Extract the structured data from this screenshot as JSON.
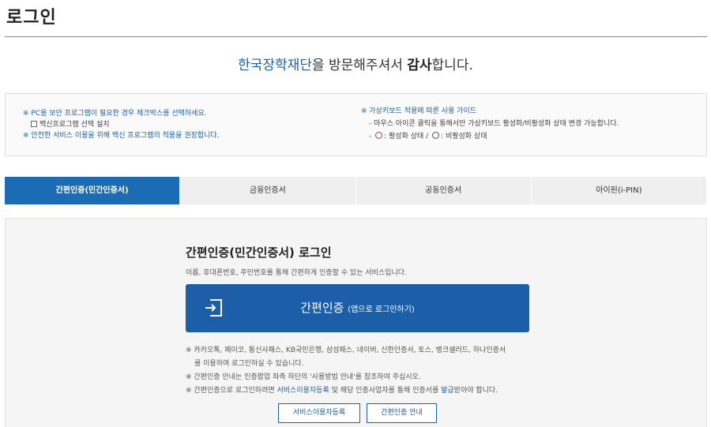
{
  "page": {
    "title": "로그인"
  },
  "welcome": {
    "brand": "한국장학재단",
    "mid": "을 방문해주셔서 ",
    "thanks": "감사",
    "end": "합니다."
  },
  "notice": {
    "left_line1": "※ PC용 보안 프로그램이 필요한 경우 체크박스를 선택하세요.",
    "checkbox_label": "백신프로그램 선택 설치",
    "left_line3": "※ 안전한 서비스 이용을 위해 백신 프로그램의 적용을 권장합니다.",
    "right_title": "※ 가상키보드 적용에 따른 사용 가이드",
    "right_line2": "- 마우스 아이콘 클릭을 통해서만 가상키보드 활성화/비활성화 상태 변경 가능합니다.",
    "right_active": ": 활성화 상태 /",
    "right_inactive": ": 비활성화 상태"
  },
  "tabs": [
    {
      "label": "간편인증(민간인증서)",
      "active": true
    },
    {
      "label": "금융인증서",
      "active": false
    },
    {
      "label": "공동인증서",
      "active": false
    },
    {
      "label": "아이핀(i-PIN)",
      "active": false
    }
  ],
  "panel": {
    "title": "간편인증(민간인증서) 로그인",
    "desc": "이름, 휴대폰번호, 주민번호를 통해 간편하게 인증할 수 있는 서비스입니다.",
    "login_main": "간편인증 ",
    "login_sub": "(앱으로 로그인하기)",
    "note1": "※ 카카오톡, 페이코, 통신사패스, KB국민은행, 삼성패스, 네이버, 신한인증서, 토스, 뱅크샐러드, 하나인증서",
    "note1b": "를 이용하여 로그인하실 수 있습니다.",
    "note2": "※ 간편인증 안내는 인증팝업 좌측 하단의 '사용방법 안내'를 참조하여 주십시오.",
    "note3_a": "※ 간편인증으로 로그인하려면 ",
    "note3_link1": "서비스이용자등록",
    "note3_b": " 및 해당 인증사업자를 통해 인증서를 ",
    "note3_link2": "발급",
    "note3_c": "받아야 합니다.",
    "btn_register": "서비스이용자등록",
    "btn_guide": "간편인증 안내"
  },
  "colors": {
    "accent": "#1c5fa8",
    "tab_active": "#1c6bb5"
  }
}
